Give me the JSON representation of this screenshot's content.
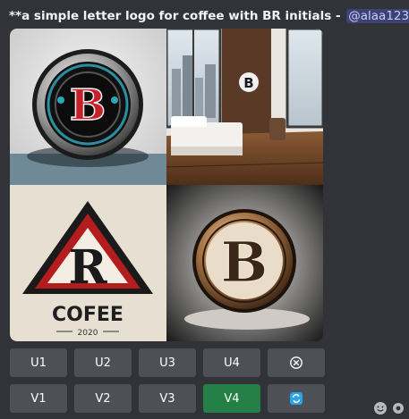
{
  "message": {
    "prompt": "**a simple letter logo for coffee with BR initials -",
    "mention": "@alaa123"
  },
  "images": [
    {
      "letter": "B"
    },
    {
      "letter": "B"
    },
    {
      "letter": "R",
      "brand": "COFEE",
      "year": "2020"
    },
    {
      "letter": "B"
    }
  ],
  "buttons": {
    "upscale": [
      "U1",
      "U2",
      "U3",
      "U4"
    ],
    "variation": [
      "V1",
      "V2",
      "V3",
      "V4"
    ],
    "selected": "V4",
    "reroll_icon": "reroll-icon",
    "cancel_icon": "cancel-circle-icon"
  },
  "colors": {
    "background": "#313338",
    "button": "#4e5058",
    "selected_button": "#248046",
    "mention_text": "#c9cdfb",
    "reroll_icon": "#2aa4e2"
  }
}
